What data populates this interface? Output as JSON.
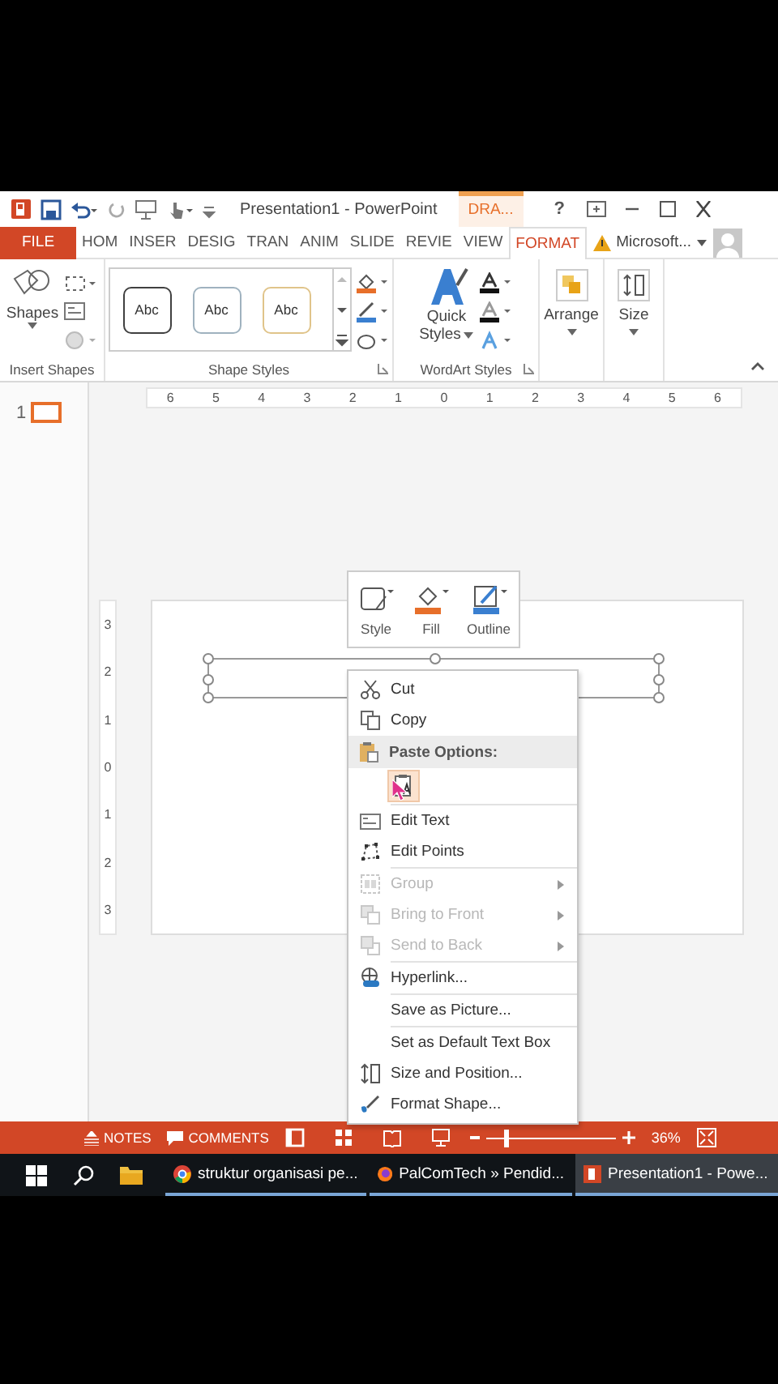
{
  "title_bar": {
    "title": "Presentation1 - PowerPoint",
    "context_tab": "DRA...",
    "help": "?"
  },
  "tabs": [
    {
      "label": "FILE",
      "kind": "file",
      "selected": false
    },
    {
      "label": "HOM",
      "kind": "tab",
      "selected": false
    },
    {
      "label": "INSER",
      "kind": "tab",
      "selected": false
    },
    {
      "label": "DESIG",
      "kind": "tab",
      "selected": false
    },
    {
      "label": "TRAN",
      "kind": "tab",
      "selected": false
    },
    {
      "label": "ANIM",
      "kind": "tab",
      "selected": false
    },
    {
      "label": "SLIDE",
      "kind": "tab",
      "selected": false
    },
    {
      "label": "REVIE",
      "kind": "tab",
      "selected": false
    },
    {
      "label": "VIEW",
      "kind": "tab",
      "selected": false
    },
    {
      "label": "FORMAT",
      "kind": "tab",
      "selected": true
    }
  ],
  "account": {
    "label": "Microsoft..."
  },
  "ribbon": {
    "insert_shapes": {
      "label": "Insert Shapes",
      "shapes": "Shapes"
    },
    "shape_styles": {
      "label": "Shape Styles",
      "swatches": [
        {
          "text": "Abc",
          "color": "#404040"
        },
        {
          "text": "Abc",
          "color": "#9fb2bf"
        },
        {
          "text": "Abc",
          "color": "#e0c48a"
        }
      ]
    },
    "wordart_styles": {
      "label": "WordArt Styles",
      "quick": "Quick",
      "styles": "Styles"
    },
    "arrange": "Arrange",
    "size": "Size"
  },
  "thumbnails": [
    {
      "number": "1",
      "selected": true
    }
  ],
  "ruler": {
    "horizontal": [
      "6",
      "5",
      "4",
      "3",
      "2",
      "1",
      "0",
      "1",
      "2",
      "3",
      "4",
      "5",
      "6"
    ],
    "vertical": [
      "3",
      "2",
      "1",
      "0",
      "1",
      "2",
      "3"
    ]
  },
  "mini_toolbar": [
    {
      "label": "Style",
      "kind": "style"
    },
    {
      "label": "Fill",
      "kind": "fill"
    },
    {
      "label": "Outline",
      "kind": "outline"
    }
  ],
  "context_menu": [
    {
      "kind": "item",
      "label": "Cut",
      "disabled": false,
      "submenu": false
    },
    {
      "kind": "item",
      "label": "Copy",
      "disabled": false,
      "submenu": false
    },
    {
      "kind": "header",
      "label": "Paste Options:"
    },
    {
      "kind": "paste"
    },
    {
      "kind": "separator"
    },
    {
      "kind": "item",
      "label": "Edit Text",
      "disabled": false,
      "submenu": false
    },
    {
      "kind": "item",
      "label": "Edit Points",
      "disabled": false,
      "submenu": false
    },
    {
      "kind": "separator"
    },
    {
      "kind": "item",
      "label": "Group",
      "disabled": true,
      "submenu": true
    },
    {
      "kind": "item",
      "label": "Bring to Front",
      "disabled": true,
      "submenu": true
    },
    {
      "kind": "item",
      "label": "Send to Back",
      "disabled": true,
      "submenu": true
    },
    {
      "kind": "separator"
    },
    {
      "kind": "item",
      "label": "Hyperlink...",
      "disabled": false,
      "submenu": false
    },
    {
      "kind": "separator"
    },
    {
      "kind": "item",
      "label": "Save as Picture...",
      "disabled": false,
      "submenu": false
    },
    {
      "kind": "separator"
    },
    {
      "kind": "item",
      "label": "Set as Default Text Box",
      "disabled": false,
      "submenu": false
    },
    {
      "kind": "item",
      "label": "Size and Position...",
      "disabled": false,
      "submenu": false
    },
    {
      "kind": "item",
      "label": "Format Shape...",
      "disabled": false,
      "submenu": false
    }
  ],
  "status_bar": {
    "notes": "NOTES",
    "comments": "COMMENTS",
    "zoom": {
      "level": 0.15
    },
    "zoom_reading": "36%"
  },
  "taskbar": [
    {
      "label": "struktur organisasi pe...",
      "selected": false
    },
    {
      "label": "PalComTech » Pendid...",
      "selected": false
    },
    {
      "label": "Presentation1 - Powe...",
      "selected": true
    }
  ]
}
